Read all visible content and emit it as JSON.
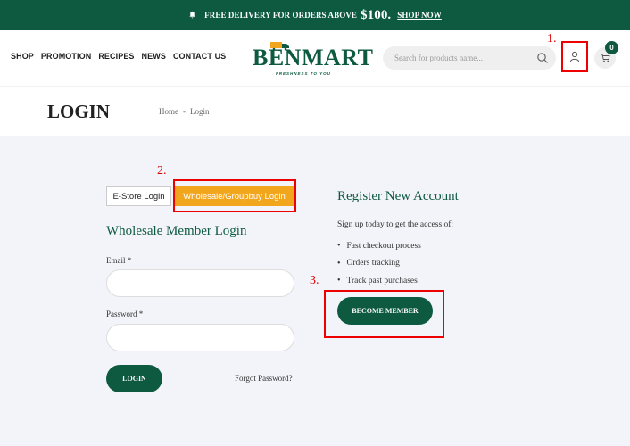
{
  "topbar": {
    "text": "FREE DELIVERY FOR ORDERS ABOVE",
    "amount": "$100.",
    "link": "SHOP NOW"
  },
  "nav": [
    "SHOP",
    "PROMOTION",
    "RECIPES",
    "NEWS",
    "CONTACT US"
  ],
  "logo": {
    "ben": "BEN",
    "mart": "MART",
    "tagline": "FRESHNESS TO YOU"
  },
  "search": {
    "placeholder": "Search for products name..."
  },
  "cart": {
    "count": "0"
  },
  "annotations": {
    "one": "1.",
    "two": "2.",
    "three": "3."
  },
  "page": {
    "title": "LOGIN",
    "breadcrumb_home": "Home",
    "breadcrumb_sep": "-",
    "breadcrumb_current": "Login"
  },
  "tabs": {
    "estore": "E-Store Login",
    "wholesale": "Wholesale/Groupbuy Login"
  },
  "login": {
    "title": "Wholesale Member Login",
    "email_label": "Email *",
    "password_label": "Password *",
    "button": "LOGIN",
    "forgot": "Forgot Password?"
  },
  "register": {
    "title": "Register New Account",
    "subtitle": "Sign up today to get the access of:",
    "items": [
      "Fast checkout process",
      "Orders tracking",
      "Track past purchases"
    ],
    "button": "BECOME MEMBER"
  },
  "colors": {
    "brand": "#0d5a40",
    "accent": "#f2a61d",
    "annotation": "#e00000"
  }
}
